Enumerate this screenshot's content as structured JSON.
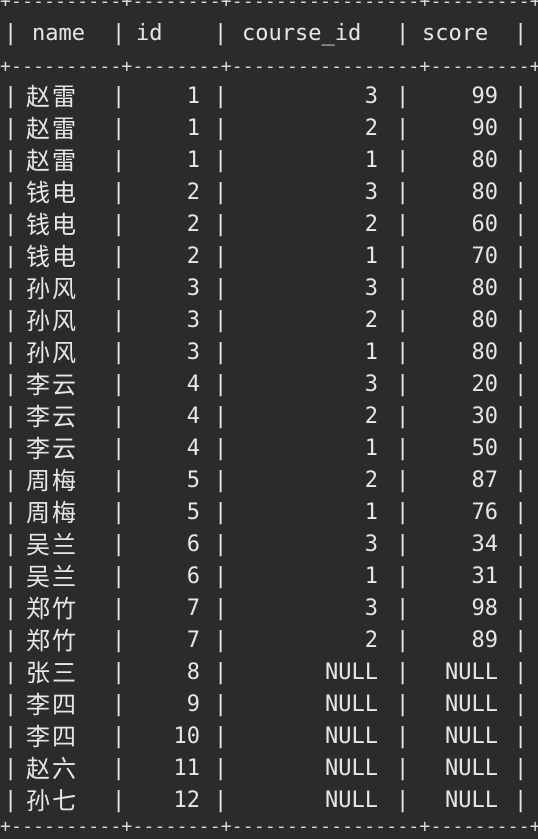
{
  "table": {
    "border_dashes": "+----------+--------+-----------------+---------+",
    "columns": [
      "name",
      "id",
      "course_id",
      "score"
    ],
    "rows": [
      {
        "name": "赵雷",
        "id": "1",
        "course_id": "3",
        "score": "99"
      },
      {
        "name": "赵雷",
        "id": "1",
        "course_id": "2",
        "score": "90"
      },
      {
        "name": "赵雷",
        "id": "1",
        "course_id": "1",
        "score": "80"
      },
      {
        "name": "钱电",
        "id": "2",
        "course_id": "3",
        "score": "80"
      },
      {
        "name": "钱电",
        "id": "2",
        "course_id": "2",
        "score": "60"
      },
      {
        "name": "钱电",
        "id": "2",
        "course_id": "1",
        "score": "70"
      },
      {
        "name": "孙风",
        "id": "3",
        "course_id": "3",
        "score": "80"
      },
      {
        "name": "孙风",
        "id": "3",
        "course_id": "2",
        "score": "80"
      },
      {
        "name": "孙风",
        "id": "3",
        "course_id": "1",
        "score": "80"
      },
      {
        "name": "李云",
        "id": "4",
        "course_id": "3",
        "score": "20"
      },
      {
        "name": "李云",
        "id": "4",
        "course_id": "2",
        "score": "30"
      },
      {
        "name": "李云",
        "id": "4",
        "course_id": "1",
        "score": "50"
      },
      {
        "name": "周梅",
        "id": "5",
        "course_id": "2",
        "score": "87"
      },
      {
        "name": "周梅",
        "id": "5",
        "course_id": "1",
        "score": "76"
      },
      {
        "name": "吴兰",
        "id": "6",
        "course_id": "3",
        "score": "34"
      },
      {
        "name": "吴兰",
        "id": "6",
        "course_id": "1",
        "score": "31"
      },
      {
        "name": "郑竹",
        "id": "7",
        "course_id": "3",
        "score": "98"
      },
      {
        "name": "郑竹",
        "id": "7",
        "course_id": "2",
        "score": "89"
      },
      {
        "name": "张三",
        "id": "8",
        "course_id": "NULL",
        "score": "NULL"
      },
      {
        "name": "李四",
        "id": "9",
        "course_id": "NULL",
        "score": "NULL"
      },
      {
        "name": "李四",
        "id": "10",
        "course_id": "NULL",
        "score": "NULL"
      },
      {
        "name": "赵六",
        "id": "11",
        "course_id": "NULL",
        "score": "NULL"
      },
      {
        "name": "孙七",
        "id": "12",
        "course_id": "NULL",
        "score": "NULL"
      }
    ]
  },
  "colors": {
    "background": "#2b2b2b",
    "text": "#e6e6e6"
  }
}
